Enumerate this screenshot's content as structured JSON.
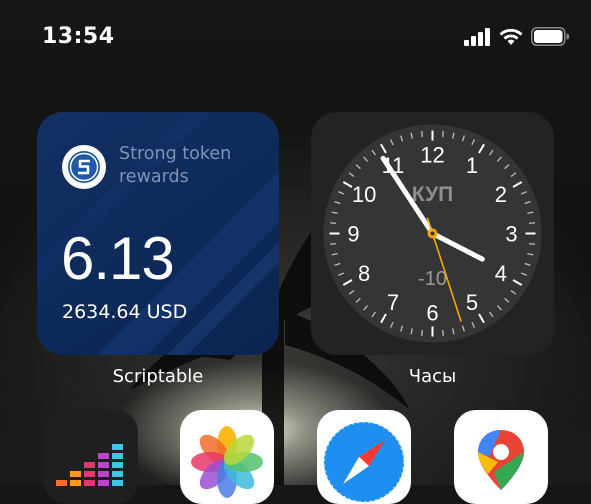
{
  "status_bar": {
    "time": "13:54",
    "signal_icon": "cellular-signal-icon",
    "wifi_icon": "wifi-icon",
    "battery_icon": "battery-icon"
  },
  "widgets": {
    "strong": {
      "title": "Strong token rewards",
      "value": "6.13",
      "usd": "2634.64 USD",
      "app_label": "Scriptable",
      "logo_icon": "strong-token-logo-icon",
      "colors": {
        "background": "#0e2b5b",
        "title_text": "#7f93b5"
      }
    },
    "clock": {
      "city": "КУП",
      "offset": "-10",
      "app_label": "Часы",
      "numerals": [
        "12",
        "1",
        "2",
        "3",
        "4",
        "5",
        "6",
        "7",
        "8",
        "9",
        "10",
        "11"
      ],
      "time_shown": {
        "hour": 3,
        "minute": 54,
        "second": 27
      },
      "colors": {
        "face": "#353535",
        "second_hand": "#f7a600"
      }
    }
  },
  "dock_apps": [
    {
      "name": "deezer-app-icon"
    },
    {
      "name": "photos-app-icon"
    },
    {
      "name": "safari-app-icon"
    },
    {
      "name": "google-maps-app-icon"
    }
  ]
}
